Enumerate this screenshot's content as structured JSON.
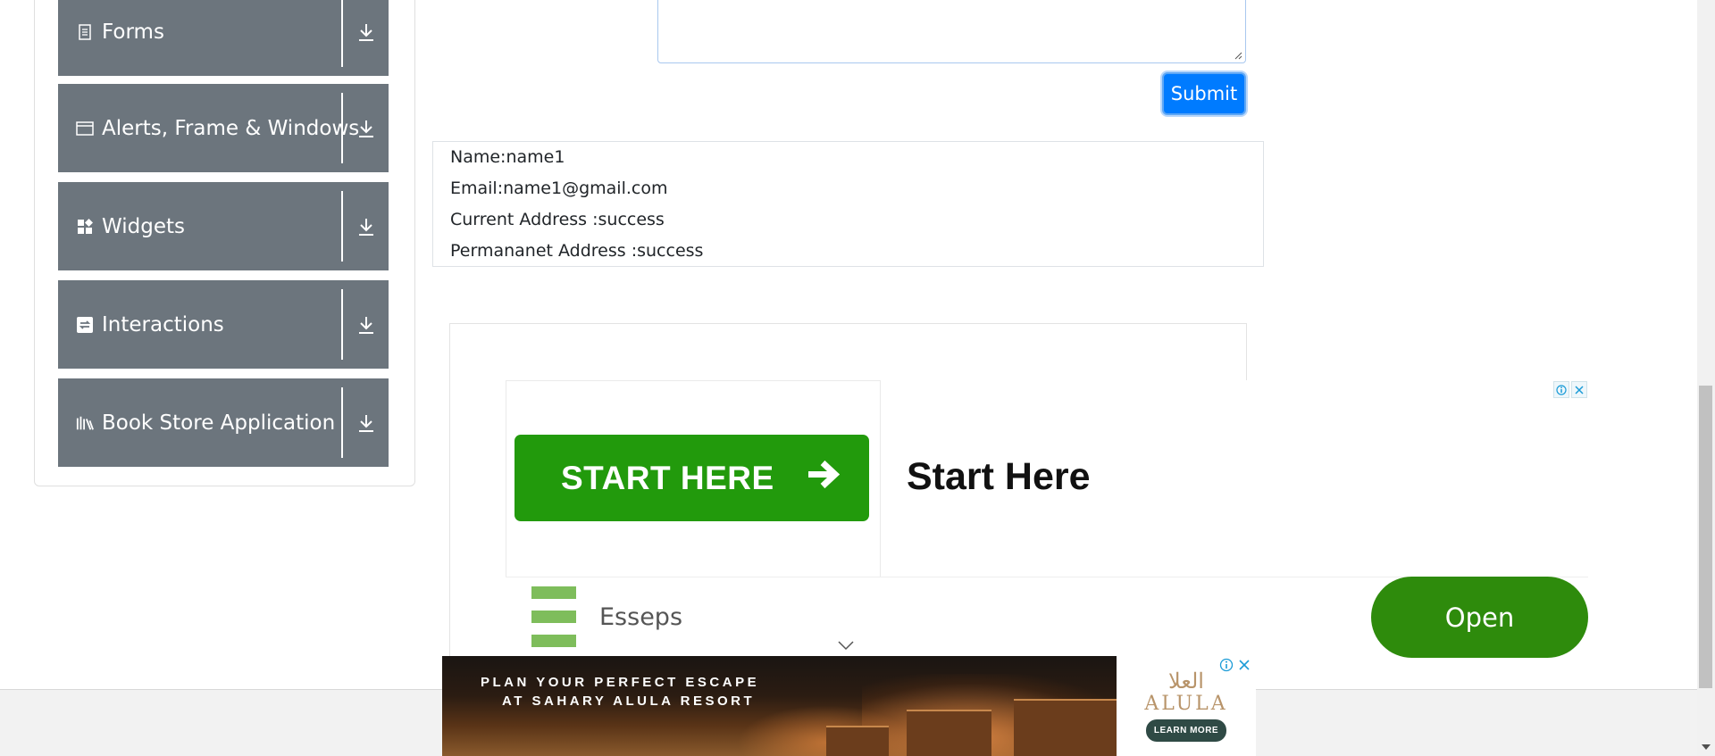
{
  "sidebar": {
    "groups": [
      {
        "label": "Forms",
        "icon": "form-icon"
      },
      {
        "label": "Alerts, Frame & Windows",
        "icon": "window-icon"
      },
      {
        "label": "Widgets",
        "icon": "widgets-icon"
      },
      {
        "label": "Interactions",
        "icon": "interactions-icon"
      },
      {
        "label": "Book Store Application",
        "icon": "books-icon"
      }
    ]
  },
  "form": {
    "submit_label": "Submit"
  },
  "output": {
    "name": "Name:name1",
    "email": "Email:name1@gmail.com",
    "current_address": "Current Address :success",
    "permanent_address": "Permananet Address :success"
  },
  "ad": {
    "cta_label": "START HERE",
    "headline": "Start Here",
    "brand": "Esseps",
    "open_label": "Open"
  },
  "banner": {
    "line1": "PLAN YOUR PERFECT ESCAPE",
    "line2": "AT SAHARY ALULA RESORT",
    "logo_arabic": "العلا",
    "logo_latin": "ALULA",
    "learn_more": "LEARN MORE"
  },
  "colors": {
    "sidebar_group": "#6c757d",
    "submit": "#007bff",
    "ad_cta": "#229a0c",
    "ad_open": "#2e8b0c"
  }
}
